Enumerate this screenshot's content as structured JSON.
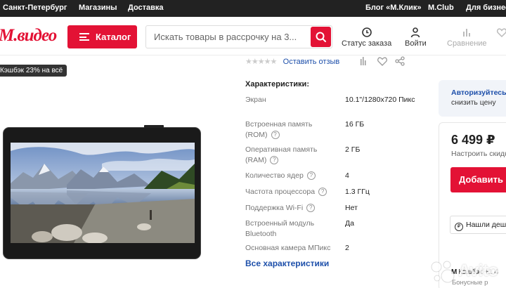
{
  "topbar": {
    "city": "Санкт-Петербург",
    "stores": "Магазины",
    "delivery": "Доставка",
    "blog": "Блог «М.Клик»",
    "club": "M.Club",
    "business": "Для бизнеса"
  },
  "header": {
    "logo": "М.видео",
    "catalog_label": "Каталог",
    "search_placeholder": "Искать товары в рассрочку на 3...",
    "order_status": "Статус заказа",
    "login": "Войти",
    "compare": "Сравнение"
  },
  "badges": {
    "cashback": "Кэшбэк 23% на всё"
  },
  "rating": {
    "stars": 0,
    "review_link": "Оставить отзыв"
  },
  "specs": {
    "title": "Характеристики:",
    "rows": [
      {
        "label": "Экран",
        "value": "10.1\"/1280x720 Пикс",
        "help": false
      },
      {
        "label": "Встроенная память (ROM)",
        "value": "16 ГБ",
        "help": true
      },
      {
        "label": "Оперативная память (RAM)",
        "value": "2 ГБ",
        "help": true
      },
      {
        "label": "Количество ядер",
        "value": "4",
        "help": true
      },
      {
        "label": "Частота процессора",
        "value": "1.3 ГГц",
        "help": true
      },
      {
        "label": "Поддержка Wi-Fi",
        "value": "Нет",
        "help": true
      },
      {
        "label": "Встроенный модуль Bluetooth",
        "value": "Да",
        "help": false
      },
      {
        "label": "Основная камера МПикс",
        "value": "2",
        "help": false
      }
    ],
    "all_link": "Все характеристики"
  },
  "side": {
    "login_text": "Авторизуйтесь,",
    "login_text_2": "снизить цену"
  },
  "price": {
    "value": "6 499 ₽",
    "sub": "Настроить скидку",
    "add_button": "Добавить",
    "cheaper": "Нашли дешевле?",
    "cashback_prefix": "M",
    "cashback": "Кэшбэк +1 4",
    "bonus": "Бонусные р"
  },
  "watermark": "Avito",
  "colors": {
    "brand": "#e31235",
    "link": "#1d4faa",
    "topbar": "#222222"
  }
}
